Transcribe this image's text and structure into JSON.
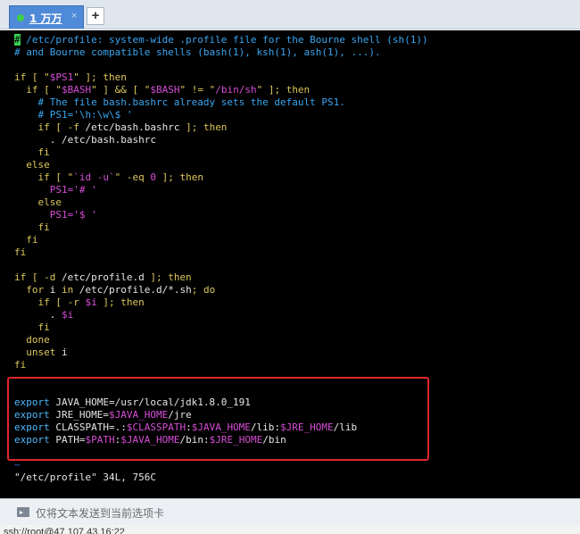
{
  "tabs": [
    {
      "label": "1 万万",
      "close": "×"
    }
  ],
  "new_tab_label": "+",
  "terminal": {
    "lines": [
      [
        {
          "c": "cursor",
          "t": "#"
        },
        {
          "c": "comment",
          "t": " /etc/profile: system-wide .profile file for the Bourne shell (sh(1))"
        }
      ],
      [
        {
          "c": "comment",
          "t": "# and Bourne compatible shells (bash(1), ksh(1), ash(1), ...)."
        }
      ],
      [],
      [
        {
          "c": "kw",
          "t": "if [ \""
        },
        {
          "c": "var",
          "t": "$PS1"
        },
        {
          "c": "kw",
          "t": "\" ]; then"
        }
      ],
      [
        {
          "c": "kw",
          "t": "  if [ \""
        },
        {
          "c": "var",
          "t": "$BASH"
        },
        {
          "c": "kw",
          "t": "\" ] && [ \""
        },
        {
          "c": "var",
          "t": "$BASH"
        },
        {
          "c": "kw",
          "t": "\" != \""
        },
        {
          "c": "str",
          "t": "/bin/sh"
        },
        {
          "c": "kw",
          "t": "\" ]; then"
        }
      ],
      [
        {
          "c": "comment",
          "t": "    # The file bash.bashrc already sets the default PS1."
        }
      ],
      [
        {
          "c": "comment",
          "t": "    # PS1='\\h:\\w\\$ '"
        }
      ],
      [
        {
          "c": "kw",
          "t": "    if [ -f "
        },
        {
          "c": "plain",
          "t": "/etc/bash.bashrc"
        },
        {
          "c": "kw",
          "t": " ]; then"
        }
      ],
      [
        {
          "c": "plain",
          "t": "      . /etc/bash.bashrc"
        }
      ],
      [
        {
          "c": "kw",
          "t": "    fi"
        }
      ],
      [
        {
          "c": "kw",
          "t": "  else"
        }
      ],
      [
        {
          "c": "kw",
          "t": "    if [ \""
        },
        {
          "c": "str",
          "t": "`id -u`"
        },
        {
          "c": "kw",
          "t": "\" -eq "
        },
        {
          "c": "var",
          "t": "0"
        },
        {
          "c": "kw",
          "t": " ]; then"
        }
      ],
      [
        {
          "c": "var",
          "t": "      PS1="
        },
        {
          "c": "str",
          "t": "'# '"
        }
      ],
      [
        {
          "c": "kw",
          "t": "    else"
        }
      ],
      [
        {
          "c": "var",
          "t": "      PS1="
        },
        {
          "c": "str",
          "t": "'$ '"
        }
      ],
      [
        {
          "c": "kw",
          "t": "    fi"
        }
      ],
      [
        {
          "c": "kw",
          "t": "  fi"
        }
      ],
      [
        {
          "c": "kw",
          "t": "fi"
        }
      ],
      [],
      [
        {
          "c": "kw",
          "t": "if [ -d "
        },
        {
          "c": "plain",
          "t": "/etc/profile.d"
        },
        {
          "c": "kw",
          "t": " ]; then"
        }
      ],
      [
        {
          "c": "kw",
          "t": "  for "
        },
        {
          "c": "plain",
          "t": "i"
        },
        {
          "c": "kw",
          "t": " in "
        },
        {
          "c": "plain",
          "t": "/etc/profile.d/*.sh"
        },
        {
          "c": "kw",
          "t": "; do"
        }
      ],
      [
        {
          "c": "kw",
          "t": "    if [ -r "
        },
        {
          "c": "var",
          "t": "$i"
        },
        {
          "c": "kw",
          "t": " ]; then"
        }
      ],
      [
        {
          "c": "plain",
          "t": "      . "
        },
        {
          "c": "var",
          "t": "$i"
        }
      ],
      [
        {
          "c": "kw",
          "t": "    fi"
        }
      ],
      [
        {
          "c": "kw",
          "t": "  done"
        }
      ],
      [
        {
          "c": "kw",
          "t": "  unset "
        },
        {
          "c": "plain",
          "t": "i"
        }
      ],
      [
        {
          "c": "kw",
          "t": "fi"
        }
      ],
      [],
      [],
      [
        {
          "c": "export",
          "t": "export "
        },
        {
          "c": "plain",
          "t": "JAVA_HOME=/usr/local/jdk1.8.0_191"
        }
      ],
      [
        {
          "c": "export",
          "t": "export "
        },
        {
          "c": "plain",
          "t": "JRE_HOME="
        },
        {
          "c": "var",
          "t": "$JAVA_HOME"
        },
        {
          "c": "plain",
          "t": "/jre"
        }
      ],
      [
        {
          "c": "export",
          "t": "export "
        },
        {
          "c": "plain",
          "t": "CLASSPATH=.:"
        },
        {
          "c": "var",
          "t": "$CLASSPATH"
        },
        {
          "c": "plain",
          "t": ":"
        },
        {
          "c": "var",
          "t": "$JAVA_HOME"
        },
        {
          "c": "plain",
          "t": "/lib:"
        },
        {
          "c": "var",
          "t": "$JRE_HOME"
        },
        {
          "c": "plain",
          "t": "/lib"
        }
      ],
      [
        {
          "c": "export",
          "t": "export "
        },
        {
          "c": "plain",
          "t": "PATH="
        },
        {
          "c": "var",
          "t": "$PATH"
        },
        {
          "c": "plain",
          "t": ":"
        },
        {
          "c": "var",
          "t": "$JAVA_HOME"
        },
        {
          "c": "plain",
          "t": "/bin:"
        },
        {
          "c": "var",
          "t": "$JRE_HOME"
        },
        {
          "c": "plain",
          "t": "/bin"
        }
      ],
      [],
      [
        {
          "c": "tilde",
          "t": "~"
        }
      ],
      [
        {
          "c": "plain",
          "t": "\"/etc/profile\" 34L, 756C"
        }
      ]
    ]
  },
  "send_bar": {
    "text": "仅将文本发送到当前选项卡"
  },
  "status_bar": {
    "text": "ssh://root@47.107.43.16:22"
  },
  "colors": {
    "accent_tab": "#4f8ad9",
    "highlight_border": "#e0262c",
    "terminal_bg": "#000000"
  }
}
